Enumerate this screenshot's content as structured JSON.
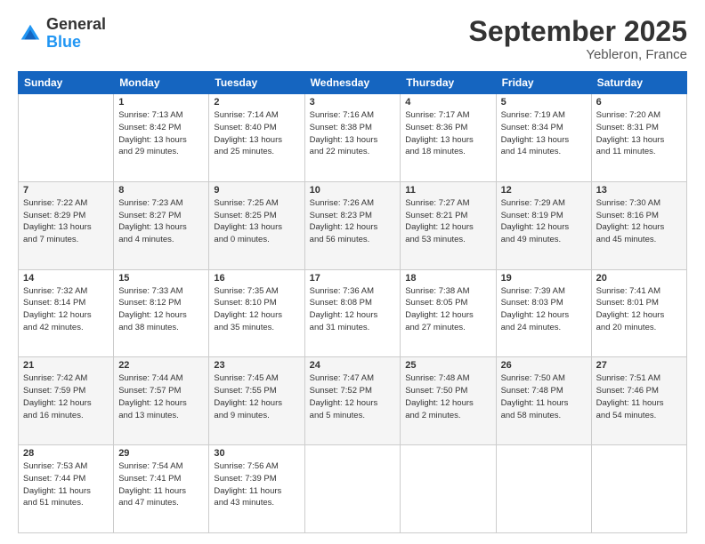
{
  "header": {
    "logo_general": "General",
    "logo_blue": "Blue",
    "month_title": "September 2025",
    "location": "Yebleron, France"
  },
  "days_of_week": [
    "Sunday",
    "Monday",
    "Tuesday",
    "Wednesday",
    "Thursday",
    "Friday",
    "Saturday"
  ],
  "weeks": [
    [
      {
        "day": "",
        "info": ""
      },
      {
        "day": "1",
        "info": "Sunrise: 7:13 AM\nSunset: 8:42 PM\nDaylight: 13 hours\nand 29 minutes."
      },
      {
        "day": "2",
        "info": "Sunrise: 7:14 AM\nSunset: 8:40 PM\nDaylight: 13 hours\nand 25 minutes."
      },
      {
        "day": "3",
        "info": "Sunrise: 7:16 AM\nSunset: 8:38 PM\nDaylight: 13 hours\nand 22 minutes."
      },
      {
        "day": "4",
        "info": "Sunrise: 7:17 AM\nSunset: 8:36 PM\nDaylight: 13 hours\nand 18 minutes."
      },
      {
        "day": "5",
        "info": "Sunrise: 7:19 AM\nSunset: 8:34 PM\nDaylight: 13 hours\nand 14 minutes."
      },
      {
        "day": "6",
        "info": "Sunrise: 7:20 AM\nSunset: 8:31 PM\nDaylight: 13 hours\nand 11 minutes."
      }
    ],
    [
      {
        "day": "7",
        "info": "Sunrise: 7:22 AM\nSunset: 8:29 PM\nDaylight: 13 hours\nand 7 minutes."
      },
      {
        "day": "8",
        "info": "Sunrise: 7:23 AM\nSunset: 8:27 PM\nDaylight: 13 hours\nand 4 minutes."
      },
      {
        "day": "9",
        "info": "Sunrise: 7:25 AM\nSunset: 8:25 PM\nDaylight: 13 hours\nand 0 minutes."
      },
      {
        "day": "10",
        "info": "Sunrise: 7:26 AM\nSunset: 8:23 PM\nDaylight: 12 hours\nand 56 minutes."
      },
      {
        "day": "11",
        "info": "Sunrise: 7:27 AM\nSunset: 8:21 PM\nDaylight: 12 hours\nand 53 minutes."
      },
      {
        "day": "12",
        "info": "Sunrise: 7:29 AM\nSunset: 8:19 PM\nDaylight: 12 hours\nand 49 minutes."
      },
      {
        "day": "13",
        "info": "Sunrise: 7:30 AM\nSunset: 8:16 PM\nDaylight: 12 hours\nand 45 minutes."
      }
    ],
    [
      {
        "day": "14",
        "info": "Sunrise: 7:32 AM\nSunset: 8:14 PM\nDaylight: 12 hours\nand 42 minutes."
      },
      {
        "day": "15",
        "info": "Sunrise: 7:33 AM\nSunset: 8:12 PM\nDaylight: 12 hours\nand 38 minutes."
      },
      {
        "day": "16",
        "info": "Sunrise: 7:35 AM\nSunset: 8:10 PM\nDaylight: 12 hours\nand 35 minutes."
      },
      {
        "day": "17",
        "info": "Sunrise: 7:36 AM\nSunset: 8:08 PM\nDaylight: 12 hours\nand 31 minutes."
      },
      {
        "day": "18",
        "info": "Sunrise: 7:38 AM\nSunset: 8:05 PM\nDaylight: 12 hours\nand 27 minutes."
      },
      {
        "day": "19",
        "info": "Sunrise: 7:39 AM\nSunset: 8:03 PM\nDaylight: 12 hours\nand 24 minutes."
      },
      {
        "day": "20",
        "info": "Sunrise: 7:41 AM\nSunset: 8:01 PM\nDaylight: 12 hours\nand 20 minutes."
      }
    ],
    [
      {
        "day": "21",
        "info": "Sunrise: 7:42 AM\nSunset: 7:59 PM\nDaylight: 12 hours\nand 16 minutes."
      },
      {
        "day": "22",
        "info": "Sunrise: 7:44 AM\nSunset: 7:57 PM\nDaylight: 12 hours\nand 13 minutes."
      },
      {
        "day": "23",
        "info": "Sunrise: 7:45 AM\nSunset: 7:55 PM\nDaylight: 12 hours\nand 9 minutes."
      },
      {
        "day": "24",
        "info": "Sunrise: 7:47 AM\nSunset: 7:52 PM\nDaylight: 12 hours\nand 5 minutes."
      },
      {
        "day": "25",
        "info": "Sunrise: 7:48 AM\nSunset: 7:50 PM\nDaylight: 12 hours\nand 2 minutes."
      },
      {
        "day": "26",
        "info": "Sunrise: 7:50 AM\nSunset: 7:48 PM\nDaylight: 11 hours\nand 58 minutes."
      },
      {
        "day": "27",
        "info": "Sunrise: 7:51 AM\nSunset: 7:46 PM\nDaylight: 11 hours\nand 54 minutes."
      }
    ],
    [
      {
        "day": "28",
        "info": "Sunrise: 7:53 AM\nSunset: 7:44 PM\nDaylight: 11 hours\nand 51 minutes."
      },
      {
        "day": "29",
        "info": "Sunrise: 7:54 AM\nSunset: 7:41 PM\nDaylight: 11 hours\nand 47 minutes."
      },
      {
        "day": "30",
        "info": "Sunrise: 7:56 AM\nSunset: 7:39 PM\nDaylight: 11 hours\nand 43 minutes."
      },
      {
        "day": "",
        "info": ""
      },
      {
        "day": "",
        "info": ""
      },
      {
        "day": "",
        "info": ""
      },
      {
        "day": "",
        "info": ""
      }
    ]
  ]
}
